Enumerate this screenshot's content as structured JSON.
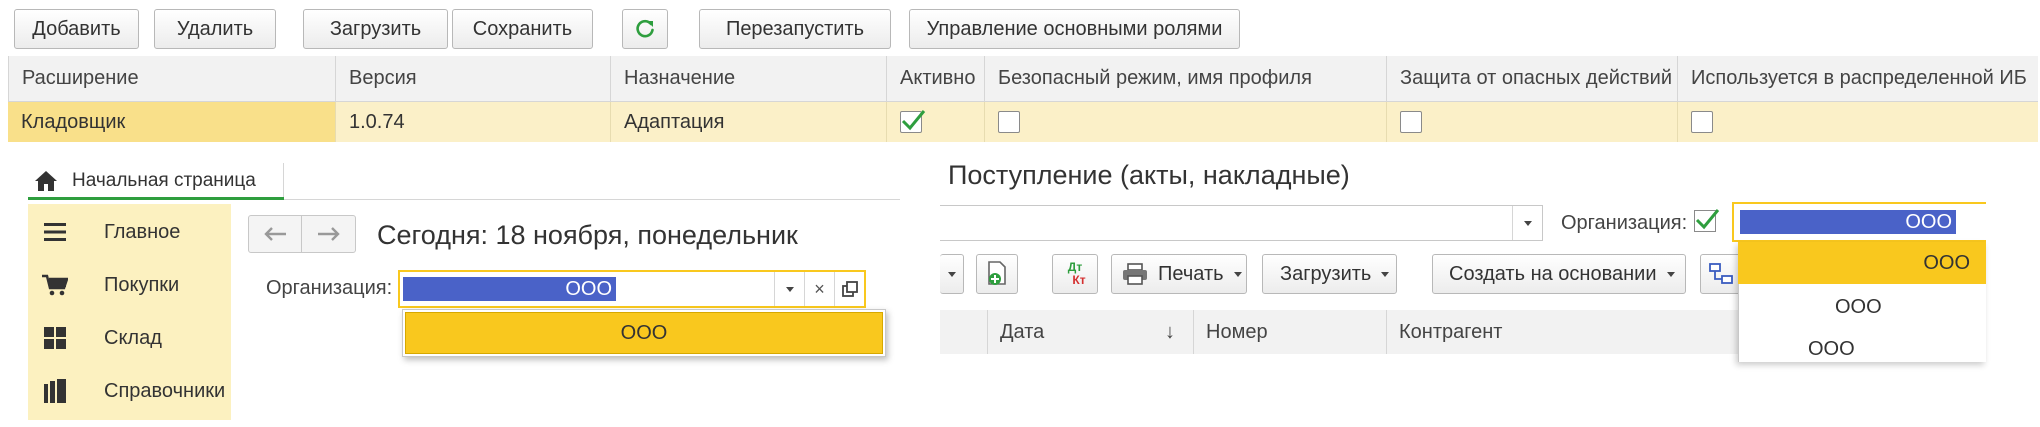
{
  "toolbar": {
    "add": "Добавить",
    "delete": "Удалить",
    "load": "Загрузить",
    "save": "Сохранить",
    "restart": "Перезапустить",
    "roles": "Управление основными ролями"
  },
  "extensions_table": {
    "headers": [
      "Расширение",
      "Версия",
      "Назначение",
      "Активно",
      "Безопасный режим, имя профиля",
      "Защита от опасных действий",
      "Используется в распределенной ИБ"
    ],
    "row": {
      "extension": "Кладовщик",
      "version": "1.0.74",
      "purpose": "Адаптация",
      "active": true,
      "safe_mode": false,
      "protection": false,
      "distributed": false
    }
  },
  "home": {
    "tab": "Начальная страница",
    "sidebar": [
      "Главное",
      "Покупки",
      "Склад",
      "Справочники"
    ],
    "today": "Сегодня: 18 ноября, понедельник",
    "org_label": "Организация:",
    "org_value": "ООО",
    "org_option": "ООО"
  },
  "receipt": {
    "title": "Поступление (акты, накладные)",
    "org_label": "Организация:",
    "org_checked": true,
    "org_value": "ООО",
    "dropdown": [
      "ООО",
      "ООО",
      "ООО"
    ],
    "buttons": {
      "dtkt_top": "Дт",
      "dtkt_bottom": "Кт",
      "print": "Печать",
      "load": "Загрузить",
      "create_based": "Создать на основании"
    },
    "columns": [
      "Дата",
      "↓",
      "Номер",
      "Контрагент"
    ]
  },
  "colors": {
    "accent_yellow": "#f9c81e",
    "selection_blue": "#4a62c8",
    "row_highlight": "#fbf0c8",
    "sidebar_bg": "#fcf1c0",
    "green_check": "#2e9e3e"
  }
}
